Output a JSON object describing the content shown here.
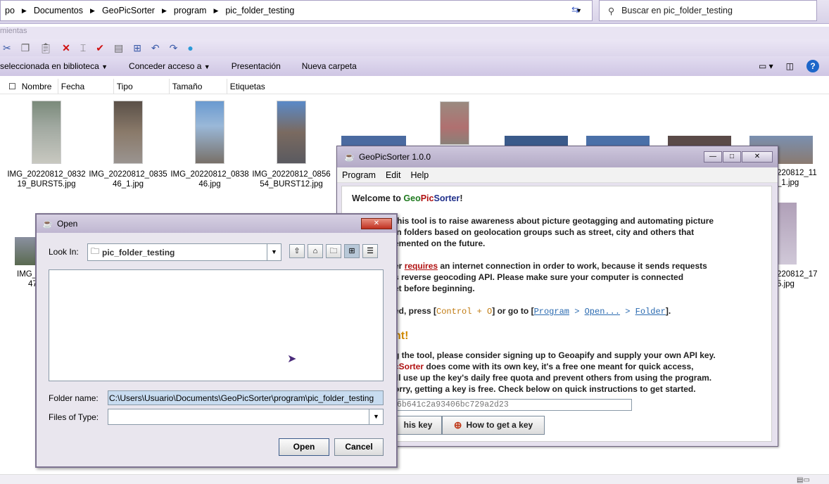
{
  "explorer": {
    "breadcrumbs": [
      "po",
      "Documentos",
      "GeoPicSorter",
      "program",
      "pic_folder_testing"
    ],
    "search_placeholder": "Buscar en pic_folder_testing",
    "menu_label": "mientas",
    "commands": [
      "seleccionada en biblioteca",
      "Conceder acceso a",
      "Presentación",
      "Nueva carpeta"
    ],
    "columns": [
      "Nombre",
      "Fecha",
      "Tipo",
      "Tamaño",
      "Etiquetas"
    ],
    "files": [
      "IMG_20220812_083219_BURST5.jpg",
      "IMG_20220812_083546_1.jpg",
      "IMG_20220812_083846.jpg",
      "IMG_20220812_085654_BURST12.jpg"
    ],
    "partial_files": [
      "IMG_",
      "47",
      "220812_11",
      "_1.jpg",
      "220812_17",
      "5.jpg"
    ]
  },
  "geo_window": {
    "title": "GeoPicSorter 1.0.0",
    "menu": [
      "Program",
      "Edit",
      "Help"
    ],
    "welcome_prefix": "Welcome to ",
    "brand_geo": "Geo",
    "brand_pic": "Pic",
    "brand_sorter": "Sorter",
    "welcome_suffix": "!",
    "para1": [
      "this tool is to raise awareness about picture geotagging and automating picture",
      "in folders based on geolocation groups such as street, city and others that",
      "emented on the future."
    ],
    "para2_prefix": "er ",
    "para2_link": "requires",
    "para2_rest": " an internet connection in order to work, because it sends requests",
    "para2_lines": [
      "s reverse geocoding API. Please make sure your computer is connected",
      "et before beginning."
    ],
    "para3_prefix": "ed, press [",
    "shortcut": "Control + O",
    "para3_mid": "] or go to [",
    "path_program": "Program",
    "path_sep": " > ",
    "path_open": "Open...",
    "path_folder": "Folder",
    "para3_end": "].",
    "heading": "nt!",
    "para4": [
      "g the tool, please consider signing up to Geoapify and supply your own API key.",
      "does come with its own key, it's a free one meant for quick access,",
      "'ll use up the key's daily free quota and prevent others from using the program.",
      "orry, getting a key is free. Check below on quick instructions to get started."
    ],
    "para4_brand": "cSorter",
    "api_key": "6b641c2a93406bc729a2d23",
    "btn_use_key": "his key",
    "btn_how": "How to get a key",
    "accent_green": "#1f7a1f",
    "accent_red": "#b01010",
    "accent_orange": "#d08a00"
  },
  "open_dialog": {
    "title": "Open",
    "look_in_label": "Look In:",
    "look_in_value": "pic_folder_testing",
    "folder_name_label": "Folder name:",
    "folder_name_value": "C:\\Users\\Usuario\\Documents\\GeoPicSorter\\program\\pic_folder_testing",
    "files_of_type_label": "Files of Type:",
    "files_of_type_value": "",
    "open_button": "Open",
    "cancel_button": "Cancel"
  }
}
